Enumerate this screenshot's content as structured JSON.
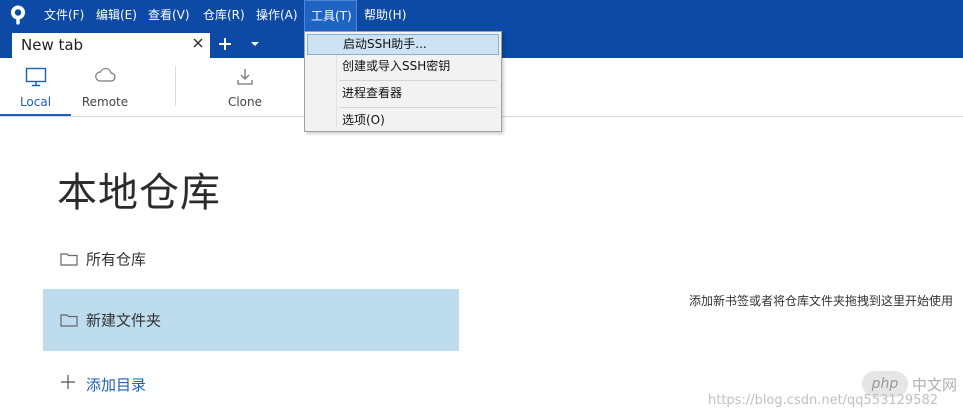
{
  "colors": {
    "menubar": "#0c4aa6",
    "accent": "#1b5fb8",
    "selected_row": "#bddcee",
    "dropdown_highlight": "#cde3f3"
  },
  "menubar": {
    "items": [
      "文件(F)",
      "编辑(E)",
      "查看(V)",
      "仓库(R)",
      "操作(A)",
      "工具(T)",
      "帮助(H)"
    ],
    "active_item": "工具(T)"
  },
  "tabs": {
    "items": [
      {
        "label": "New tab"
      }
    ]
  },
  "toolbar": {
    "local_label": "Local",
    "remote_label": "Remote",
    "clone_label": "Clone",
    "selected": "Local"
  },
  "tools_menu": {
    "items": [
      "启动SSH助手...",
      "创建或导入SSH密钥",
      "进程查看器",
      "选项(O)"
    ],
    "highlighted": "启动SSH助手..."
  },
  "main": {
    "title": "本地仓库",
    "nav": [
      {
        "label": "所有仓库"
      },
      {
        "label": "新建文件夹",
        "selected": true
      }
    ],
    "add_label": "添加目录",
    "hint": "添加新书签或者将仓库文件夹拖拽到这里开始使用"
  },
  "watermark": {
    "logo_text": "php",
    "site_text": "中文网",
    "url": "https://blog.csdn.net/qq553129582"
  }
}
